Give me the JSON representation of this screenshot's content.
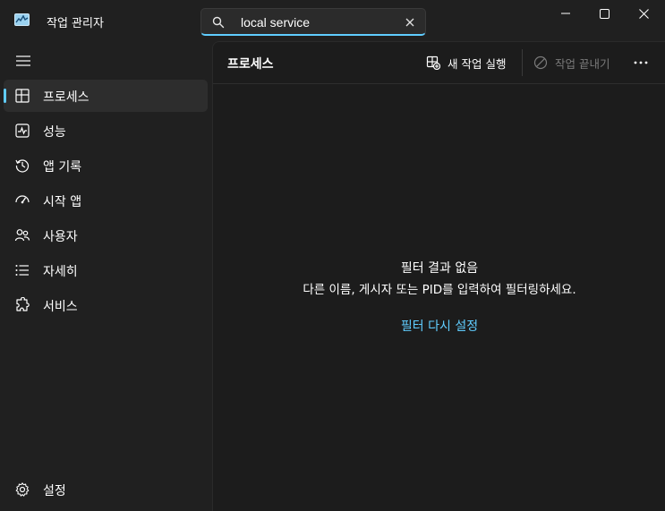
{
  "window": {
    "title": "작업 관리자"
  },
  "search": {
    "value": "local service",
    "placeholder": ""
  },
  "sidebar": {
    "items": [
      {
        "label": "프로세스",
        "icon": "processes-grid-icon",
        "active": true
      },
      {
        "label": "성능",
        "icon": "performance-pulse-icon",
        "active": false
      },
      {
        "label": "앱 기록",
        "icon": "history-icon",
        "active": false
      },
      {
        "label": "시작 앱",
        "icon": "startup-gauge-icon",
        "active": false
      },
      {
        "label": "사용자",
        "icon": "users-icon",
        "active": false
      },
      {
        "label": "자세히",
        "icon": "details-list-icon",
        "active": false
      },
      {
        "label": "서비스",
        "icon": "services-puzzle-icon",
        "active": false
      }
    ],
    "settings_label": "설정"
  },
  "toolbar": {
    "title": "프로세스",
    "run_new_task": "새 작업 실행",
    "end_task": "작업 끝내기"
  },
  "empty_state": {
    "title": "필터 결과 없음",
    "description": "다른 이름, 게시자 또는 PID를 입력하여 필터링하세요.",
    "reset_link": "필터 다시 설정"
  },
  "colors": {
    "accent": "#60cdff",
    "background": "#202020",
    "content_background": "#1c1c1c",
    "disabled_text": "#7a7a7a"
  }
}
